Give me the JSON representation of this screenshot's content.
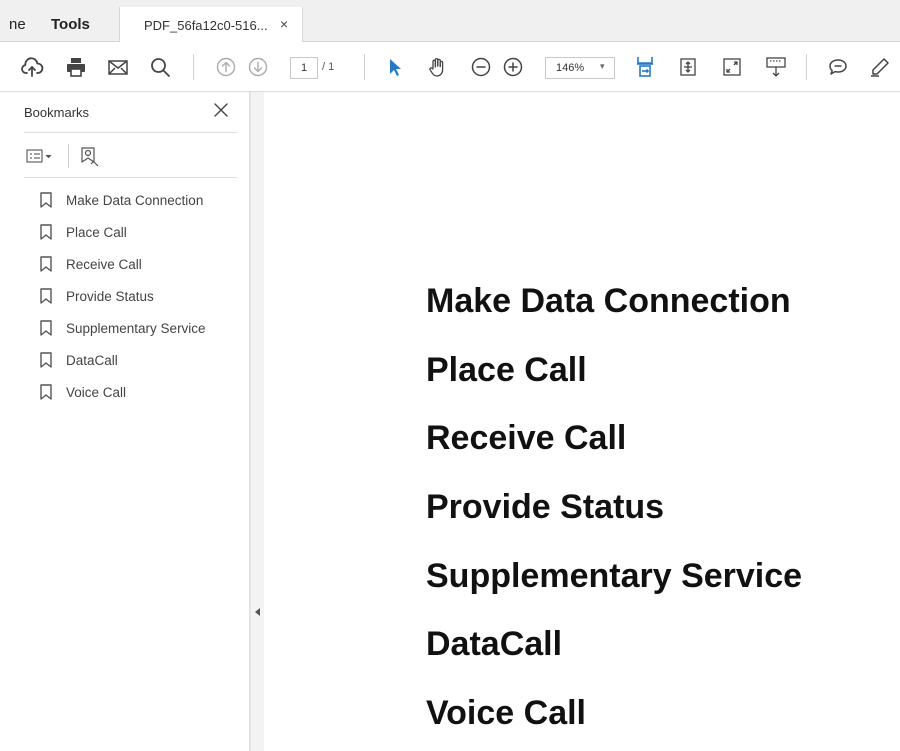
{
  "tabs": {
    "home_label": "ne",
    "tools_label": "Tools",
    "document_label": "PDF_56fa12c0-516...",
    "close_glyph": "×"
  },
  "toolbar": {
    "page_current": "1",
    "page_total": "/ 1",
    "zoom": "146%",
    "zoom_caret": "▾",
    "accent_color": "#2679c9"
  },
  "bookmarks_panel": {
    "title": "Bookmarks",
    "items": [
      {
        "label": "Make Data Connection"
      },
      {
        "label": "Place Call"
      },
      {
        "label": "Receive Call"
      },
      {
        "label": "Provide Status"
      },
      {
        "label": "Supplementary Service"
      },
      {
        "label": "DataCall"
      },
      {
        "label": "Voice Call"
      }
    ]
  },
  "document": {
    "headings": [
      "Make Data Connection",
      "Place Call",
      "Receive Call",
      "Provide Status",
      "Supplementary Service",
      "DataCall",
      "Voice Call"
    ]
  }
}
